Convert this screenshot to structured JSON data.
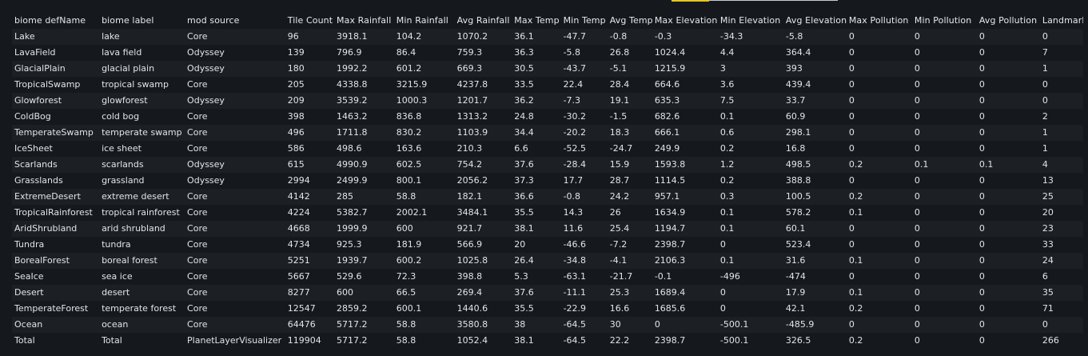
{
  "table": {
    "headers": [
      "biome defName",
      "biome label",
      "mod source",
      "Tile Count",
      "Max Rainfall",
      "Min Rainfall",
      "Avg Rainfall",
      "Max Temp",
      "Min Temp",
      "Avg Temp",
      "Max Elevation",
      "Min Elevation",
      "Avg Elevation",
      "Max Pollution",
      "Min Pollution",
      "Avg Pollution",
      "Landmark Count"
    ],
    "rows": [
      [
        "Lake",
        "lake",
        "Core",
        "96",
        "3918.1",
        "104.2",
        "1070.2",
        "36.1",
        "-47.7",
        "-0.8",
        "-0.3",
        "-34.3",
        "-5.8",
        "0",
        "0",
        "0",
        "0"
      ],
      [
        "LavaField",
        "lava field",
        "Odyssey",
        "139",
        "796.9",
        "86.4",
        "759.3",
        "36.3",
        "-5.8",
        "26.8",
        "1024.4",
        "4.4",
        "364.4",
        "0",
        "0",
        "0",
        "7"
      ],
      [
        "GlacialPlain",
        "glacial plain",
        "Odyssey",
        "180",
        "1992.2",
        "601.2",
        "669.3",
        "30.5",
        "-43.7",
        "-5.1",
        "1215.9",
        "3",
        "393",
        "0",
        "0",
        "0",
        "1"
      ],
      [
        "TropicalSwamp",
        "tropical swamp",
        "Core",
        "205",
        "4338.8",
        "3215.9",
        "4237.8",
        "33.5",
        "22.4",
        "28.4",
        "664.6",
        "3.6",
        "439.4",
        "0",
        "0",
        "0",
        "0"
      ],
      [
        "Glowforest",
        "glowforest",
        "Odyssey",
        "209",
        "3539.2",
        "1000.3",
        "1201.7",
        "36.2",
        "-7.3",
        "19.1",
        "635.3",
        "7.5",
        "33.7",
        "0",
        "0",
        "0",
        "0"
      ],
      [
        "ColdBog",
        "cold bog",
        "Core",
        "398",
        "1463.2",
        "836.8",
        "1313.2",
        "24.8",
        "-30.2",
        "-1.5",
        "682.6",
        "0.1",
        "60.9",
        "0",
        "0",
        "0",
        "2"
      ],
      [
        "TemperateSwamp",
        "temperate swamp",
        "Core",
        "496",
        "1711.8",
        "830.2",
        "1103.9",
        "34.4",
        "-20.2",
        "18.3",
        "666.1",
        "0.6",
        "298.1",
        "0",
        "0",
        "0",
        "1"
      ],
      [
        "IceSheet",
        "ice sheet",
        "Core",
        "586",
        "498.6",
        "163.6",
        "210.3",
        "6.6",
        "-52.5",
        "-24.7",
        "249.9",
        "0.2",
        "16.8",
        "0",
        "0",
        "0",
        "1"
      ],
      [
        "Scarlands",
        "scarlands",
        "Odyssey",
        "615",
        "4990.9",
        "602.5",
        "754.2",
        "37.6",
        "-28.4",
        "15.9",
        "1593.8",
        "1.2",
        "498.5",
        "0.2",
        "0.1",
        "0.1",
        "4"
      ],
      [
        "Grasslands",
        "grassland",
        "Odyssey",
        "2994",
        "2499.9",
        "800.1",
        "2056.2",
        "37.3",
        "17.7",
        "28.7",
        "1114.5",
        "0.2",
        "388.8",
        "0",
        "0",
        "0",
        "13"
      ],
      [
        "ExtremeDesert",
        "extreme desert",
        "Core",
        "4142",
        "285",
        "58.8",
        "182.1",
        "36.6",
        "-0.8",
        "24.2",
        "957.1",
        "0.3",
        "100.5",
        "0.2",
        "0",
        "0",
        "25"
      ],
      [
        "TropicalRainforest",
        "tropical rainforest",
        "Core",
        "4224",
        "5382.7",
        "2002.1",
        "3484.1",
        "35.5",
        "14.3",
        "26",
        "1634.9",
        "0.1",
        "578.2",
        "0.1",
        "0",
        "0",
        "20"
      ],
      [
        "AridShrubland",
        "arid shrubland",
        "Core",
        "4668",
        "1999.9",
        "600",
        "921.7",
        "38.1",
        "11.6",
        "25.4",
        "1194.7",
        "0.1",
        "60.1",
        "0",
        "0",
        "0",
        "23"
      ],
      [
        "Tundra",
        "tundra",
        "Core",
        "4734",
        "925.3",
        "181.9",
        "566.9",
        "20",
        "-46.6",
        "-7.2",
        "2398.7",
        "0",
        "523.4",
        "0",
        "0",
        "0",
        "33"
      ],
      [
        "BorealForest",
        "boreal forest",
        "Core",
        "5251",
        "1939.7",
        "600.2",
        "1025.8",
        "26.4",
        "-34.8",
        "-4.1",
        "2106.3",
        "0.1",
        "31.6",
        "0.1",
        "0",
        "0",
        "24"
      ],
      [
        "SeaIce",
        "sea ice",
        "Core",
        "5667",
        "529.6",
        "72.3",
        "398.8",
        "5.3",
        "-63.1",
        "-21.7",
        "-0.1",
        "-496",
        "-474",
        "0",
        "0",
        "0",
        "6"
      ],
      [
        "Desert",
        "desert",
        "Core",
        "8277",
        "600",
        "66.5",
        "269.4",
        "37.6",
        "-11.1",
        "25.3",
        "1689.4",
        "0",
        "17.9",
        "0.1",
        "0",
        "0",
        "35"
      ],
      [
        "TemperateForest",
        "temperate forest",
        "Core",
        "12547",
        "2859.2",
        "600.1",
        "1440.6",
        "35.5",
        "-22.9",
        "16.6",
        "1685.6",
        "0",
        "42.1",
        "0.2",
        "0",
        "0",
        "71"
      ],
      [
        "Ocean",
        "ocean",
        "Core",
        "64476",
        "5717.2",
        "58.8",
        "3580.8",
        "38",
        "-64.5",
        "30",
        "0",
        "-500.1",
        "-485.9",
        "0",
        "0",
        "0",
        "0"
      ],
      [
        "Total",
        "Total",
        "PlanetLayerVisualizer",
        "119904",
        "5717.2",
        "58.8",
        "1052.4",
        "38.1",
        "-64.5",
        "22.2",
        "2398.7",
        "-500.1",
        "326.5",
        "0.2",
        "0",
        "0",
        "266"
      ]
    ]
  },
  "colors": {
    "background": "#15191e",
    "row_alt": "#1c2025",
    "text": "#e2e4e6",
    "accent": "#e8c51c"
  }
}
